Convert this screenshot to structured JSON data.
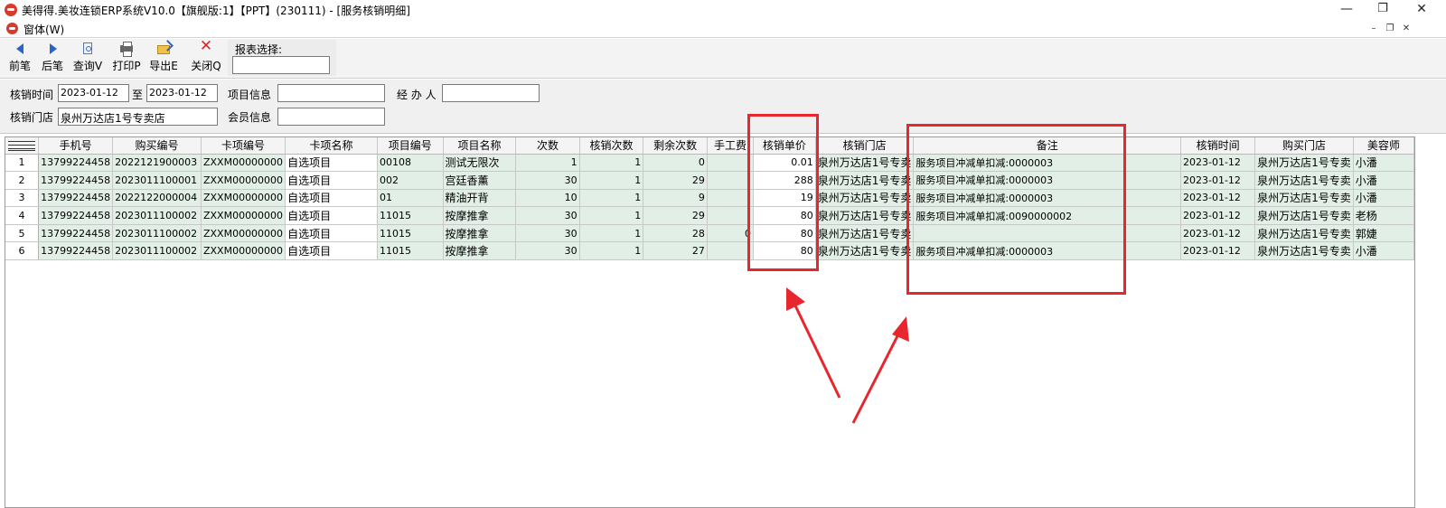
{
  "window": {
    "title": "美得得.美妆连锁ERP系统V10.0【旗舰版:1】【PPT】(230111) - [服务核销明细]",
    "minimize_glyph": "—",
    "maximize_glyph": "❐",
    "close_glyph": "✕"
  },
  "menu": {
    "window_menu": "窗体(W)",
    "mdi_min": "–",
    "mdi_restore": "❐",
    "mdi_close": "✕"
  },
  "toolbar": {
    "prev_label": "前笔",
    "next_label": "后笔",
    "query_label": "查询V",
    "print_label": "打印P",
    "export_label": "导出E",
    "close_label": "关闭Q",
    "report_select_label": "报表选择:",
    "report_select_value": ""
  },
  "filters": {
    "time_label": "核销时间",
    "date_from": "2023-01-12",
    "to_label": "至",
    "date_to": "2023-01-12",
    "item_info_label": "项目信息",
    "item_info_value": "",
    "handler_label": "经 办 人",
    "handler_value": "",
    "store_label": "核销门店",
    "store_value": "泉州万达店1号专卖店",
    "member_label": "会员信息",
    "member_value": ""
  },
  "grid": {
    "columns": [
      "手机号",
      "购买编号",
      "卡项编号",
      "卡项名称",
      "项目编号",
      "项目名称",
      "次数",
      "核销次数",
      "剩余次数",
      "手工费",
      "核销单价",
      "核销门店",
      "备注",
      "核销时间",
      "购买门店",
      "美容师"
    ],
    "rows": [
      {
        "n": "1",
        "phone": "13799224458",
        "buy_no": "2022121900003",
        "card_no": "ZXXM00000000",
        "card_name": "自选项目",
        "item_no": "00108",
        "item_name": "测试无限次",
        "times": "1",
        "used": "1",
        "remain": "0",
        "fee": "",
        "price": "0.01",
        "store": "泉州万达店1号专卖",
        "note": "服务项目冲减单扣减:0000003",
        "time": "2023-01-12",
        "buy_store": "泉州万达店1号专卖",
        "beautician": "小潘"
      },
      {
        "n": "2",
        "phone": "13799224458",
        "buy_no": "2023011100001",
        "card_no": "ZXXM00000000",
        "card_name": "自选项目",
        "item_no": "002",
        "item_name": "宫廷香薰",
        "times": "30",
        "used": "1",
        "remain": "29",
        "fee": "",
        "price": "288",
        "store": "泉州万达店1号专卖",
        "note": "服务项目冲减单扣减:0000003",
        "time": "2023-01-12",
        "buy_store": "泉州万达店1号专卖",
        "beautician": "小潘"
      },
      {
        "n": "3",
        "phone": "13799224458",
        "buy_no": "2022122000004",
        "card_no": "ZXXM00000000",
        "card_name": "自选项目",
        "item_no": "01",
        "item_name": "精油开背",
        "times": "10",
        "used": "1",
        "remain": "9",
        "fee": "",
        "price": "19",
        "store": "泉州万达店1号专卖",
        "note": "服务项目冲减单扣减:0000003",
        "time": "2023-01-12",
        "buy_store": "泉州万达店1号专卖",
        "beautician": "小潘"
      },
      {
        "n": "4",
        "phone": "13799224458",
        "buy_no": "2023011100002",
        "card_no": "ZXXM00000000",
        "card_name": "自选项目",
        "item_no": "11015",
        "item_name": "按摩推拿",
        "times": "30",
        "used": "1",
        "remain": "29",
        "fee": "",
        "price": "80",
        "store": "泉州万达店1号专卖",
        "note": "服务项目冲减单扣减:0090000002",
        "time": "2023-01-12",
        "buy_store": "泉州万达店1号专卖",
        "beautician": "老杨"
      },
      {
        "n": "5",
        "phone": "13799224458",
        "buy_no": "2023011100002",
        "card_no": "ZXXM00000000",
        "card_name": "自选项目",
        "item_no": "11015",
        "item_name": "按摩推拿",
        "times": "30",
        "used": "1",
        "remain": "28",
        "fee": "0",
        "price": "80",
        "store": "泉州万达店1号专卖",
        "note": "",
        "time": "2023-01-12",
        "buy_store": "泉州万达店1号专卖",
        "beautician": "郭婕"
      },
      {
        "n": "6",
        "phone": "13799224458",
        "buy_no": "2023011100002",
        "card_no": "ZXXM00000000",
        "card_name": "自选项目",
        "item_no": "11015",
        "item_name": "按摩推拿",
        "times": "30",
        "used": "1",
        "remain": "27",
        "fee": "",
        "price": "80",
        "store": "泉州万达店1号专卖",
        "note": "服务项目冲减单扣减:0000003",
        "time": "2023-01-12",
        "buy_store": "泉州万达店1号专卖",
        "beautician": "小潘"
      }
    ]
  },
  "colors": {
    "row_bg": "#e2efe6",
    "annotation_red": "#e8262d",
    "icon_red": "#d93a2b",
    "icon_blue": "#2d63c8"
  }
}
